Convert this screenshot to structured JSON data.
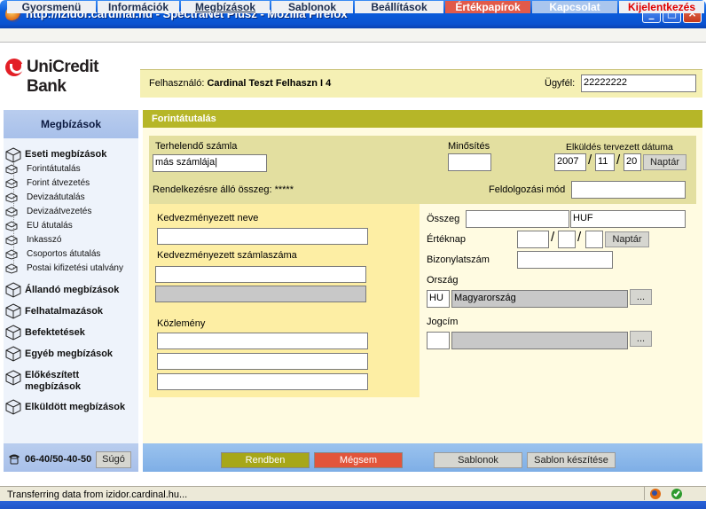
{
  "window": {
    "title": "http://izidor.cardinal.hu - SpectraNet Plusz - Mozilla Firefox",
    "min": "_",
    "max": "□",
    "close": "×"
  },
  "menu": [
    "Gyorsmenü",
    "Információk",
    "Megbízások",
    "Sablonok",
    "Beállítások",
    "Értékpapírok",
    "Kapcsolat",
    "Kijelentkezés"
  ],
  "logo": "UniCredit Bank",
  "user": {
    "label": "Felhasználó:",
    "name": "Cardinal Teszt Felhaszn I 4",
    "client_label": "Ügyfél:",
    "client_value": "22222222"
  },
  "sidebar": {
    "title": "Megbízások",
    "eseti": "Eseti megbízások",
    "sub": [
      "Forintátutalás",
      "Forint átvezetés",
      "Devizaátutalás",
      "Devizaátvezetés",
      "EU átutalás",
      "Inkasszó",
      "Csoportos átutalás",
      "Postai kifizetési utalvány"
    ],
    "groups": [
      "Állandó megbízások",
      "Felhatalmazások",
      "Befektetések",
      "Egyéb megbízások",
      "Előkészített megbízások",
      "Elküldött megbízások"
    ],
    "phone": "06-40/50-40-50",
    "help": "Súgó"
  },
  "form": {
    "title": "Forintátutalás",
    "terhelendo_label": "Terhelendő számla",
    "terhelendo_value": "más számlája|",
    "minosites_label": "Minősítés",
    "elkuldes_label": "Elküldés tervezett dátuma",
    "date": {
      "year": "2007",
      "month": "11",
      "day": "20",
      "sep": "/"
    },
    "naptar": "Naptár",
    "rendelkezesre_label": "Rendelkezésre álló összeg: *****",
    "feldolgozasi_label": "Feldolgozási mód",
    "kedv_nev_label": "Kedvezményezett neve",
    "kedv_szamla_label": "Kedvezményezett számlaszáma",
    "kozlemeny_label": "Közlemény",
    "osszeg_label": "Összeg",
    "currency": "HUF",
    "erteknap_label": "Értéknap",
    "bizonylat_label": "Bizonylatszám",
    "orszag_label": "Ország",
    "orszag_code": "HU",
    "orszag_name": "Magyarország",
    "jogcim_label": "Jogcím",
    "ellipsis": "..."
  },
  "actions": {
    "rendben": "Rendben",
    "megsem": "Mégsem",
    "sablonok": "Sablonok",
    "sablon_keszites": "Sablon készítése"
  },
  "status": "Transferring data from izidor.cardinal.hu...",
  "colors": {
    "accent": "#b6b628",
    "menu_active": "#e15a4a",
    "logout": "#e00000"
  }
}
